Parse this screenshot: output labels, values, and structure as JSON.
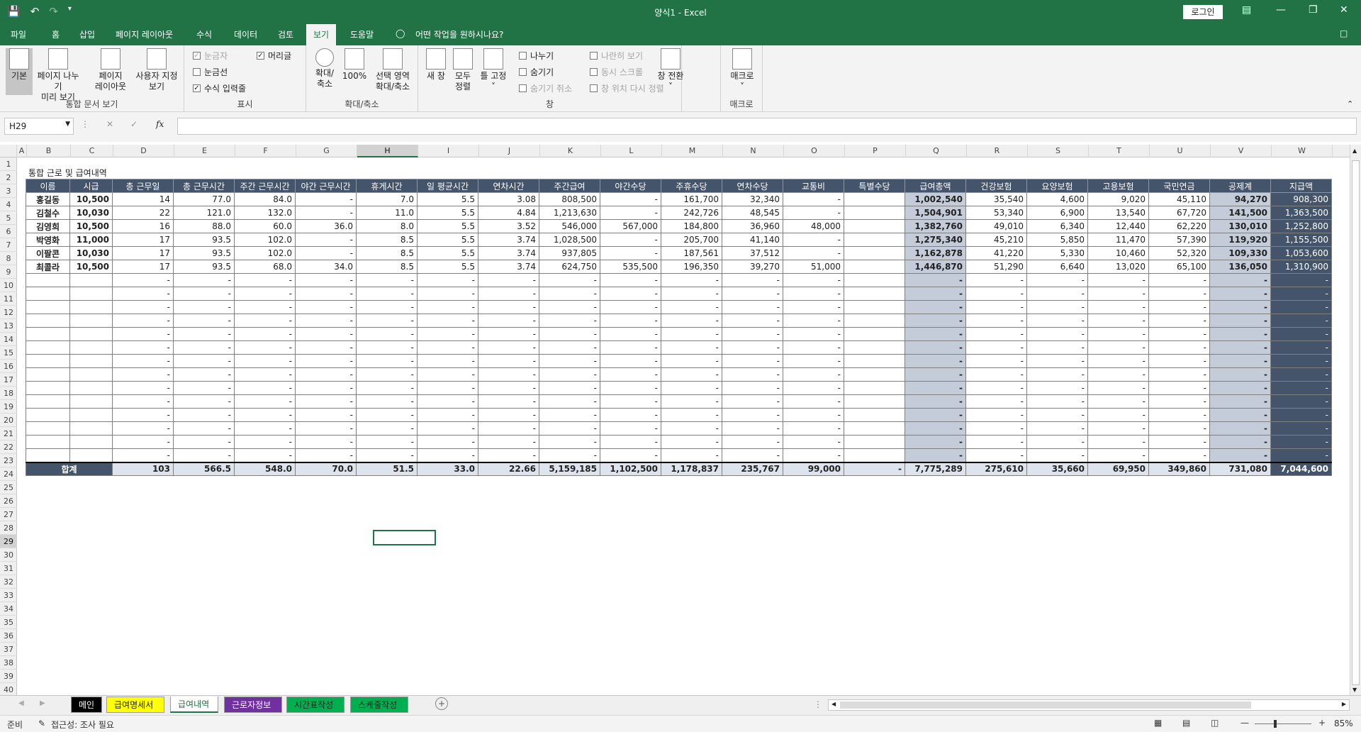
{
  "app": {
    "title": "양식1  -  Excel",
    "login": "로그인"
  },
  "tabs": [
    {
      "label": "파일",
      "active": false
    },
    {
      "label": "홈",
      "active": false
    },
    {
      "label": "삽입",
      "active": false
    },
    {
      "label": "페이지 레이아웃",
      "active": false
    },
    {
      "label": "수식",
      "active": false
    },
    {
      "label": "데이터",
      "active": false
    },
    {
      "label": "검토",
      "active": false
    },
    {
      "label": "보기",
      "active": true
    },
    {
      "label": "도움말",
      "active": false
    }
  ],
  "tell_me": "어떤 작업을 원하시나요?",
  "ribbon": {
    "workbook_views": {
      "label": "통합 문서 보기",
      "normal": "기본",
      "page_break_1": "페이지 나누기",
      "page_break_2": "미리 보기",
      "page_layout_1": "페이지",
      "page_layout_2": "레이아웃",
      "custom_1": "사용자 지정",
      "custom_2": "보기"
    },
    "show": {
      "label": "표시",
      "ruler": "눈금자",
      "gridlines": "눈금선",
      "formula_bar": "수식 입력줄",
      "headings": "머리글"
    },
    "zoom": {
      "label": "확대/축소",
      "zoom_1": "확대/",
      "zoom_2": "축소",
      "hundred": "100%",
      "sel_1": "선택 영역",
      "sel_2": "확대/축소"
    },
    "window": {
      "label": "창",
      "new_window": "새 창",
      "arrange_1": "모두",
      "arrange_2": "정렬",
      "freeze": "틀 고정",
      "split": "나누기",
      "hide": "숨기기",
      "unhide": "숨기기 취소",
      "side_by_side": "나란히 보기",
      "sync_scroll": "동시 스크롤",
      "reset_pos": "창 위치 다시 정렬",
      "switch": "창 전환"
    },
    "macros": {
      "label": "매크로",
      "macros": "매크로"
    }
  },
  "formula_bar": {
    "name_box": "H29",
    "fx": "fx",
    "formula": ""
  },
  "columns": [
    "A",
    "B",
    "C",
    "D",
    "E",
    "F",
    "G",
    "H",
    "I",
    "J",
    "K",
    "L",
    "M",
    "N",
    "O",
    "P",
    "Q",
    "R",
    "S",
    "T",
    "U",
    "V",
    "W"
  ],
  "selected_column": "H",
  "selected_row": "29",
  "rows": [
    "1",
    "2",
    "3",
    "4",
    "5",
    "6",
    "7",
    "8",
    "9",
    "10",
    "11",
    "12",
    "13",
    "14",
    "15",
    "16",
    "17",
    "18",
    "19",
    "20",
    "21",
    "22",
    "23",
    "24",
    "25",
    "26",
    "27",
    "28",
    "29",
    "30",
    "31",
    "32",
    "33",
    "34",
    "35",
    "36",
    "37",
    "38",
    "39",
    "40"
  ],
  "table": {
    "caption": "통합 근로 및 급여내역",
    "headers": [
      "이름",
      "시급",
      "총 근무일",
      "총 근무시간",
      "주간 근무시간",
      "야간 근무시간",
      "휴게시간",
      "일 평균시간",
      "연차시간",
      "주간급여",
      "야간수당",
      "주휴수당",
      "연차수당",
      "교통비",
      "특별수당",
      "급여총액",
      "건강보험",
      "요양보험",
      "고용보험",
      "국민연금",
      "공제계",
      "지급액"
    ],
    "data_rows": [
      [
        "홍길동",
        "10,500",
        "14",
        "77.0",
        "84.0",
        "-",
        "7.0",
        "5.5",
        "3.08",
        "808,500",
        "-",
        "161,700",
        "32,340",
        "-",
        "",
        "1,002,540",
        "35,540",
        "4,600",
        "9,020",
        "45,110",
        "94,270",
        "908,300"
      ],
      [
        "김철수",
        "10,030",
        "22",
        "121.0",
        "132.0",
        "-",
        "11.0",
        "5.5",
        "4.84",
        "1,213,630",
        "-",
        "242,726",
        "48,545",
        "-",
        "",
        "1,504,901",
        "53,340",
        "6,900",
        "13,540",
        "67,720",
        "141,500",
        "1,363,500"
      ],
      [
        "김영희",
        "10,500",
        "16",
        "88.0",
        "60.0",
        "36.0",
        "8.0",
        "5.5",
        "3.52",
        "546,000",
        "567,000",
        "184,800",
        "36,960",
        "48,000",
        "",
        "1,382,760",
        "49,010",
        "6,340",
        "12,440",
        "62,220",
        "130,010",
        "1,252,800"
      ],
      [
        "박영화",
        "11,000",
        "17",
        "93.5",
        "102.0",
        "-",
        "8.5",
        "5.5",
        "3.74",
        "1,028,500",
        "-",
        "205,700",
        "41,140",
        "-",
        "",
        "1,275,340",
        "45,210",
        "5,850",
        "11,470",
        "57,390",
        "119,920",
        "1,155,500"
      ],
      [
        "이팔콘",
        "10,030",
        "17",
        "93.5",
        "102.0",
        "-",
        "8.5",
        "5.5",
        "3.74",
        "937,805",
        "-",
        "187,561",
        "37,512",
        "-",
        "",
        "1,162,878",
        "41,220",
        "5,330",
        "10,460",
        "52,320",
        "109,330",
        "1,053,600"
      ],
      [
        "최콜라",
        "10,500",
        "17",
        "93.5",
        "68.0",
        "34.0",
        "8.5",
        "5.5",
        "3.74",
        "624,750",
        "535,500",
        "196,350",
        "39,270",
        "51,000",
        "",
        "1,446,870",
        "51,290",
        "6,640",
        "13,020",
        "65,100",
        "136,050",
        "1,310,900"
      ]
    ],
    "empty_row": [
      "",
      "",
      "-",
      "-",
      "-",
      "-",
      "-",
      "-",
      "-",
      "-",
      "-",
      "-",
      "-",
      "-",
      "",
      "-",
      "-",
      "-",
      "-",
      "-",
      "-",
      "-"
    ],
    "empty_row_count": 14,
    "total_row": [
      "합계",
      "",
      "103",
      "566.5",
      "548.0",
      "70.0",
      "51.5",
      "33.0",
      "22.66",
      "5,159,185",
      "1,102,500",
      "1,178,837",
      "235,767",
      "99,000",
      "-",
      "7,775,289",
      "275,610",
      "35,660",
      "69,950",
      "349,860",
      "731,080",
      "7,044,600"
    ]
  },
  "sheet_tabs": [
    {
      "label": "메인",
      "bg": "#000000",
      "fg": "#ffffff"
    },
    {
      "label": "급여명세서",
      "bg": "#ffff00",
      "fg": "#222222"
    },
    {
      "label": "급여내역",
      "bg": "#ffffff",
      "fg": "#217346",
      "active": true
    },
    {
      "label": "근로자정보",
      "bg": "#7030a0",
      "fg": "#ffffff"
    },
    {
      "label": "시간표작성",
      "bg": "#00b050",
      "fg": "#222222"
    },
    {
      "label": "스케줄작성",
      "bg": "#00b050",
      "fg": "#222222"
    }
  ],
  "status": {
    "ready": "준비",
    "accessibility": "접근성: 조사 필요",
    "zoom": "85%"
  }
}
